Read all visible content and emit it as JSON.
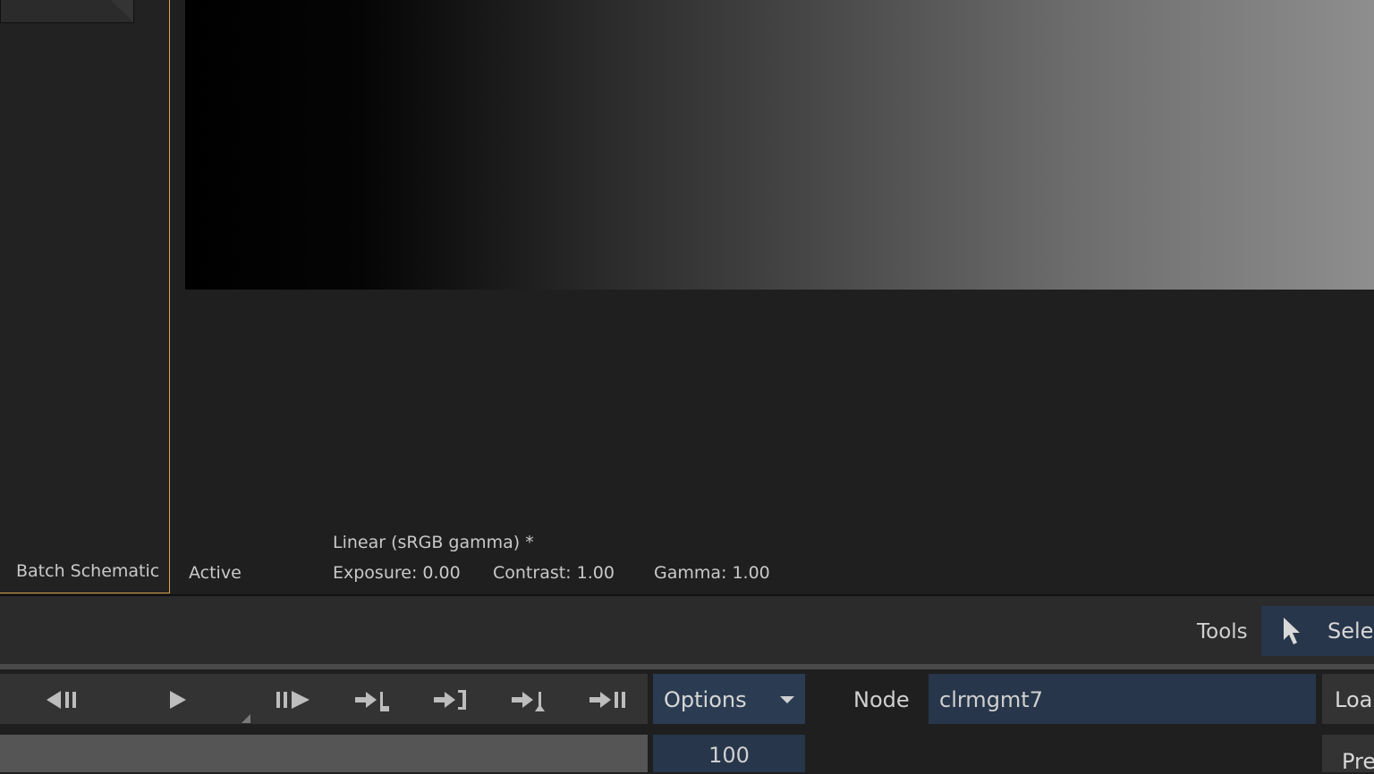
{
  "left_panel": {
    "label": "Batch Schematic"
  },
  "viewer": {
    "status": "Active",
    "colorspace": "Linear (sRGB gamma) *",
    "exposure": "Exposure: 0.00",
    "contrast": "Contrast: 1.00",
    "gamma": "Gamma: 1.00"
  },
  "tools_bar": {
    "label": "Tools",
    "select_label": "Selec",
    "select_icon": "cursor-arrow-icon"
  },
  "transport": {
    "buttons": [
      {
        "name": "step-back-icon"
      },
      {
        "name": "play-icon"
      },
      {
        "name": "step-forward-icon"
      },
      {
        "name": "jump-to-in-icon"
      },
      {
        "name": "jump-to-out-icon"
      },
      {
        "name": "jump-to-mark-icon"
      },
      {
        "name": "jump-to-end-icon"
      }
    ]
  },
  "options": {
    "label": "Options"
  },
  "node": {
    "label": "Node",
    "value": "clrmgmt7"
  },
  "load": {
    "label": "Loa"
  },
  "frame": {
    "value": "100"
  },
  "pre": {
    "label": "Pre"
  },
  "colors": {
    "accent_border": "#d8a24a",
    "field_blue": "#27364a",
    "options_blue": "#2b3c52"
  }
}
